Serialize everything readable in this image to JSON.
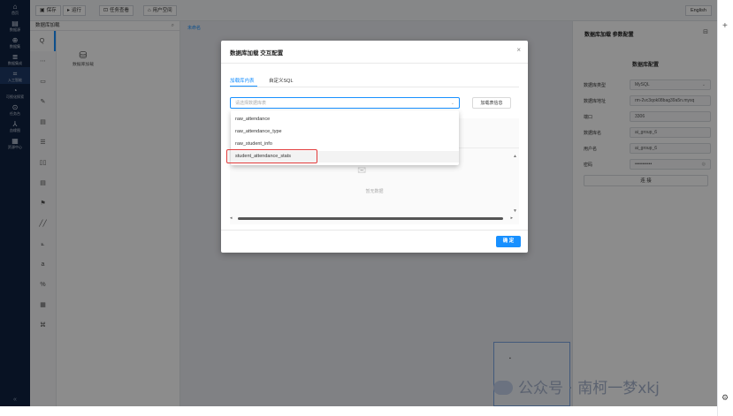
{
  "nav": {
    "items": [
      {
        "icon": "⌂",
        "label": "首页"
      },
      {
        "icon": "▤",
        "label": "数据源"
      },
      {
        "icon": "⊕",
        "label": "数据集"
      },
      {
        "icon": "≣",
        "label": "数据集成"
      },
      {
        "icon": "⌗",
        "label": "入工智能"
      },
      {
        "icon": "◔",
        "label": "可视化探索"
      },
      {
        "icon": "⊙",
        "label": "任务台"
      },
      {
        "icon": "⅄",
        "label": "血缘图"
      },
      {
        "icon": "▦",
        "label": "资源中心"
      }
    ],
    "collapse": "«"
  },
  "toolbar": {
    "save": "保存",
    "run": "运行",
    "tasks": "任务查看",
    "userspace": "用户空间",
    "lang": "English"
  },
  "panel": {
    "title": "数据库加载",
    "item_label": "数据库加载",
    "side_icons": [
      "Q",
      "⋯",
      "▭",
      "✎",
      "▤",
      "☰",
      "▯▯",
      "▤",
      "⚑",
      "╱╱",
      "⟀",
      "a",
      "%",
      "▦",
      "⌘"
    ]
  },
  "canvas": {
    "tab": "未命名"
  },
  "config": {
    "title": "数据库加载 参数配置",
    "section": "数据库配置",
    "fields": [
      {
        "label": "数据库类型",
        "value": "MySQL"
      },
      {
        "label": "数据库地址",
        "value": "rm-2vc3qok08bag39a5n.mysq"
      },
      {
        "label": "端口",
        "value": "3306"
      },
      {
        "label": "数据库名",
        "value": "ai_group_6"
      },
      {
        "label": "用户名",
        "value": "ai_group_6"
      },
      {
        "label": "密码",
        "value": "•••••••••••"
      }
    ],
    "connect": "连 接"
  },
  "modal": {
    "title": "数据库加载 交互配置",
    "tabs": [
      "加载库内表",
      "自定义SQL"
    ],
    "select_placeholder": "请选择数据库表",
    "load_button": "加载表信息",
    "empty_text": "暂无数据",
    "ok": "确 定",
    "options": [
      "raw_attendance",
      "raw_attendance_type",
      "raw_student_info",
      "student_attendance_stats"
    ]
  },
  "watermark": "公众号 · 南柯一梦xkj"
}
